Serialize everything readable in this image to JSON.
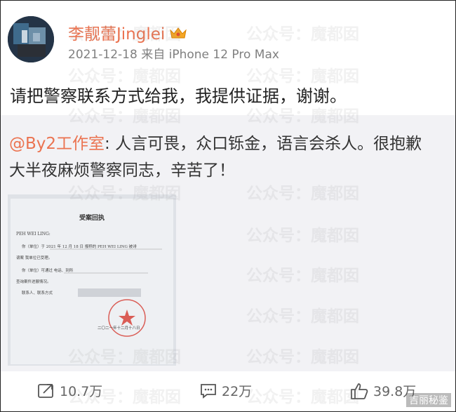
{
  "post": {
    "username": "李靓蕾Jinglei",
    "date": "2021-12-18",
    "source": "来自 iPhone 12 Pro Max",
    "text": "请把警察联系方式给我，我提供证据，谢谢。"
  },
  "repost": {
    "mention": "@By2工作室",
    "text_line1": ": 人言可畏，众口铄金，语言会杀人。很抱歉",
    "text_line2": "大半夜麻烦警察同志，辛苦了！"
  },
  "document": {
    "title": "受案回执",
    "line1": "PEH WEI LING:",
    "line2": "你（单位）于 2021 年 12 月 18 日 报称的 PEH WEI LING 被诽",
    "line3": "谤案 我单位已受理。",
    "line4": "你（单位）可通过 电话、到所",
    "line5": "查询案件进展情况。",
    "line6": "联系人、联系方式",
    "date": "二〇二一年十二月十八日"
  },
  "actions": {
    "share_count": "10.7万",
    "comment_count": "22万",
    "like_count": "39.8万"
  },
  "watermark": {
    "text": "公众号：魔都囡"
  },
  "corner_label": "吉丽秘鉴",
  "colors": {
    "accent": "#eb7350",
    "repost_bg": "#f2f2f5",
    "meta": "#808080"
  }
}
